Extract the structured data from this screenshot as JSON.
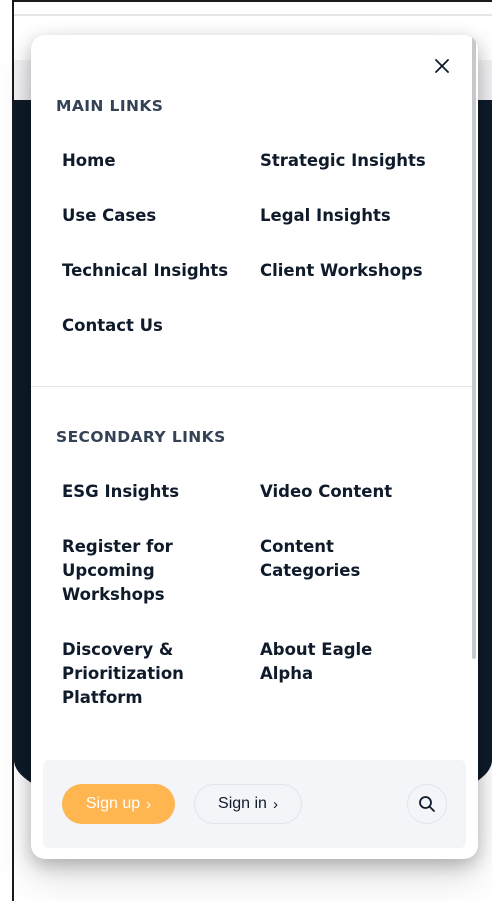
{
  "menu": {
    "close_icon": "close-icon",
    "main_section": {
      "title": "MAIN LINKS",
      "links": [
        "Home",
        "Strategic Insights",
        "Use Cases",
        "Legal Insights",
        "Technical Insights",
        "Client Workshops",
        "Contact Us"
      ]
    },
    "secondary_section": {
      "title": "SECONDARY LINKS",
      "links": [
        "ESG Insights",
        "Video Content",
        "Register for Upcoming Workshops",
        "Content Categories",
        "Discovery & Prioritization Platform",
        "About Eagle Alpha"
      ]
    },
    "actions": {
      "signup_label": "Sign up",
      "signin_label": "Sign in",
      "chevron": "›",
      "search_icon": "search-icon"
    }
  },
  "colors": {
    "signup_accent": "#ffb550",
    "text_dark": "#0f1b2a",
    "section_title": "#344256",
    "page_background": "#0f1b2a",
    "bottom_bar": "#f4f5f9"
  }
}
